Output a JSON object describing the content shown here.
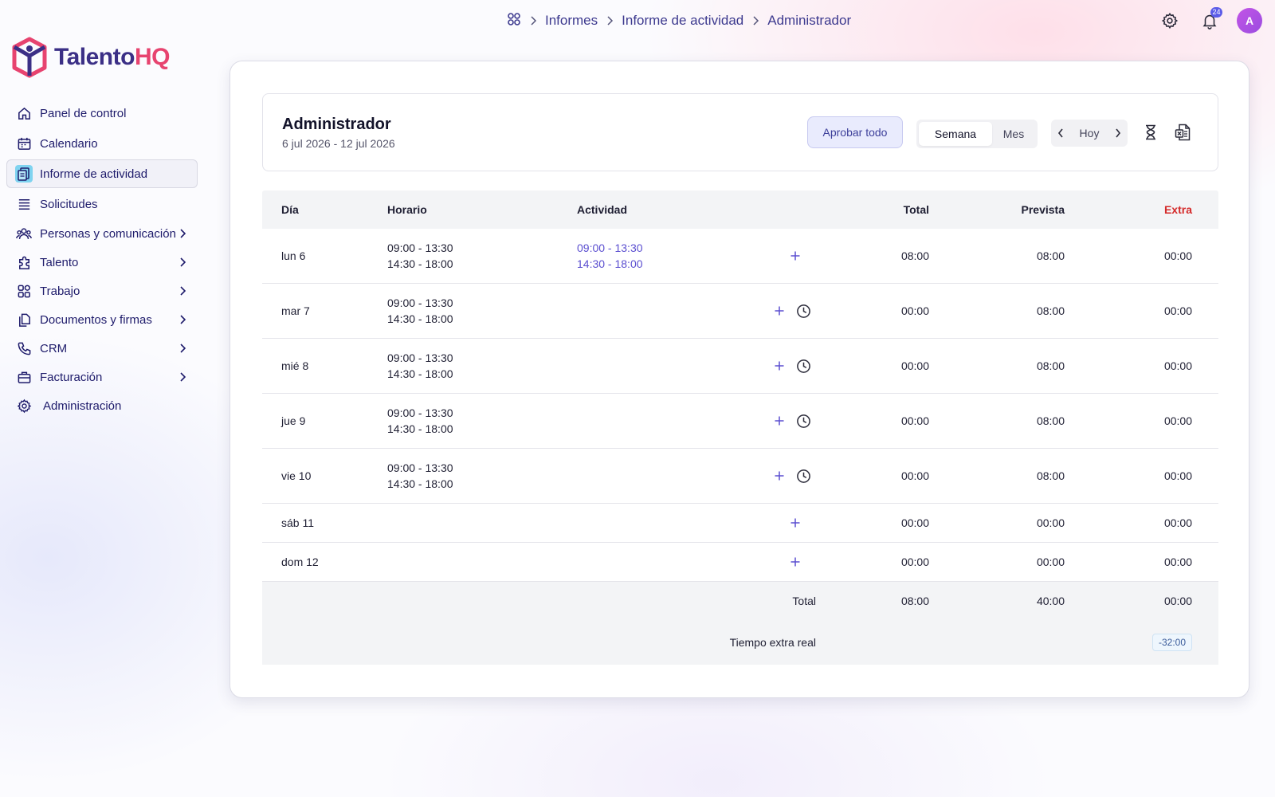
{
  "breadcrumb": {
    "items": [
      "Informes",
      "Informe de actividad",
      "Administrador"
    ]
  },
  "topbar": {
    "notification_count": "24",
    "avatar_initial": "A"
  },
  "logo": {
    "part1": "Talento",
    "part2": "HQ"
  },
  "sidebar": {
    "items": [
      {
        "label": "Panel de control",
        "icon": "home-icon"
      },
      {
        "label": "Calendario",
        "icon": "calendar-icon"
      },
      {
        "label": "Informe de actividad",
        "icon": "report-icon",
        "active": true
      },
      {
        "label": "Solicitudes",
        "icon": "list-icon"
      },
      {
        "label": "Personas y comunicación",
        "icon": "users-icon",
        "expandable": true
      },
      {
        "label": "Talento",
        "icon": "puzzle-icon",
        "expandable": true
      },
      {
        "label": "Trabajo",
        "icon": "grid-icon",
        "expandable": true
      },
      {
        "label": "Documentos y firmas",
        "icon": "documents-icon",
        "expandable": true
      },
      {
        "label": "CRM",
        "icon": "phone-icon",
        "expandable": true
      },
      {
        "label": "Facturación",
        "icon": "briefcase-icon",
        "expandable": true
      },
      {
        "label": "Administración",
        "icon": "gear-icon"
      }
    ]
  },
  "header": {
    "title": "Administrador",
    "range": "6 jul 2026 - 12 jul 2026",
    "approve_label": "Aprobar todo",
    "view_week": "Semana",
    "view_month": "Mes",
    "today_label": "Hoy"
  },
  "table": {
    "columns": {
      "day": "Día",
      "schedule": "Horario",
      "activity": "Actividad",
      "total": "Total",
      "planned": "Prevista",
      "extra": "Extra"
    },
    "rows": [
      {
        "day": "lun 6",
        "schedule": [
          "09:00 - 13:30",
          "14:30 - 18:00"
        ],
        "activity": [
          "09:00 - 13:30",
          "14:30 - 18:00"
        ],
        "total": "08:00",
        "planned": "08:00",
        "extra": "00:00"
      },
      {
        "day": "mar 7",
        "schedule": [
          "09:00 - 13:30",
          "14:30 - 18:00"
        ],
        "activity": [
          "",
          ""
        ],
        "total": "00:00",
        "planned": "08:00",
        "extra": "00:00"
      },
      {
        "day": "mié 8",
        "schedule": [
          "09:00 - 13:30",
          "14:30 - 18:00"
        ],
        "activity": [
          "",
          ""
        ],
        "total": "00:00",
        "planned": "08:00",
        "extra": "00:00"
      },
      {
        "day": "jue 9",
        "schedule": [
          "09:00 - 13:30",
          "14:30 - 18:00"
        ],
        "activity": [
          "",
          ""
        ],
        "total": "00:00",
        "planned": "08:00",
        "extra": "00:00"
      },
      {
        "day": "vie 10",
        "schedule": [
          "09:00 - 13:30",
          "14:30 - 18:00"
        ],
        "activity": [
          "",
          ""
        ],
        "total": "00:00",
        "planned": "08:00",
        "extra": "00:00"
      },
      {
        "day": "sáb 11",
        "total": "00:00",
        "planned": "00:00",
        "extra": "00:00"
      },
      {
        "day": "dom 12",
        "total": "00:00",
        "planned": "00:00",
        "extra": "00:00"
      }
    ],
    "footer": {
      "total_label": "Total",
      "total": "08:00",
      "planned": "40:00",
      "extra": "00:00",
      "real_extra_label": "Tiempo extra real",
      "real_extra": "-32:00"
    }
  },
  "colors": {
    "accent": "#5b4fd0",
    "extra_header": "#d42a2a",
    "brand_dark": "#3b2f86",
    "brand_pink": "#e7436f"
  }
}
